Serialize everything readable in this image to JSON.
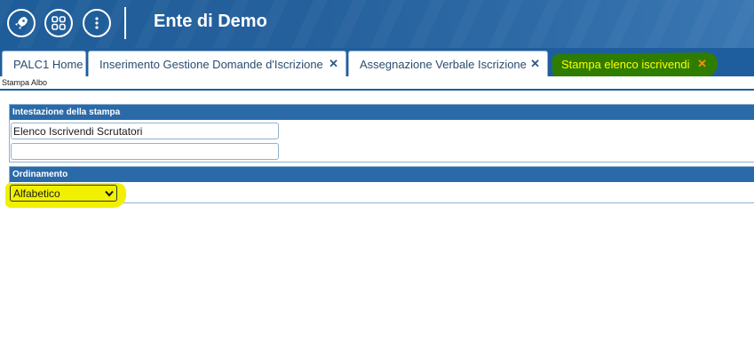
{
  "header": {
    "title": "Ente di Demo",
    "icons": [
      "rocket-icon",
      "grid-icon",
      "more-vertical-icon"
    ]
  },
  "tabs": [
    {
      "label": "PALC1 Home",
      "closable": false
    },
    {
      "label": "Inserimento Gestione Domande d'Iscrizione",
      "closable": true,
      "close": "✕"
    },
    {
      "label": "Assegnazione Verbale Iscrizione",
      "closable": true,
      "close": "✕"
    },
    {
      "label": "Stampa elenco iscrivendi",
      "closable": true,
      "close": "✕",
      "active": true
    }
  ],
  "breadcrumb": "Stampa Albo",
  "sections": {
    "intestazione": {
      "title": "Intestazione della stampa",
      "line1": "Elenco Iscrivendi Scrutatori",
      "line2": ""
    },
    "ordinamento": {
      "title": "Ordinamento",
      "selected": "Alfabetico"
    }
  },
  "colors": {
    "header_bg": "#1e5d99",
    "active_tab_text": "#ffff00",
    "close_active": "#ff8c1a",
    "highlight_green": "#2f7d00",
    "highlight_yellow": "#f0f000"
  }
}
